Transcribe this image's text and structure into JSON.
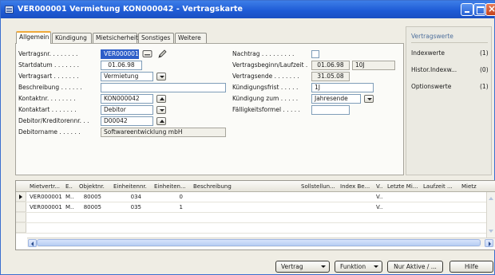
{
  "window": {
    "title": "VER000001 Vermietung KON000042 - Vertragskarte",
    "controls": {
      "minimize": "minimize-icon",
      "maximize": "maximize-icon",
      "close": "close-icon"
    }
  },
  "tabs": [
    {
      "label": "Allgemein",
      "active": true
    },
    {
      "label": "Kündigung"
    },
    {
      "label": "Mietsicherheit"
    },
    {
      "label": "Sonstiges"
    },
    {
      "label": "Weitere"
    }
  ],
  "form_left": [
    {
      "label": "Vertragsnr. . . . . . . .",
      "value": "VER000001"
    },
    {
      "label": "Startdatum . . . . . . .",
      "value": "01.06.98"
    },
    {
      "label": "Vertragsart . . . . . . .",
      "value": "Vermietung"
    },
    {
      "label": "Beschreibung . . . . . .",
      "value": ""
    },
    {
      "label": "Kontaktnr. . . . . . . .",
      "value": "KON000042"
    },
    {
      "label": "Kontaktart . . . . . . .",
      "value": "Debitor"
    },
    {
      "label": "Debitor/Kreditorennr. . .",
      "value": "D00042"
    },
    {
      "label": "Debitorname . . . . . .",
      "value": "Softwareentwicklung mbH"
    }
  ],
  "form_right": [
    {
      "label": "Nachtrag . . . . . . . . ."
    },
    {
      "label": "Vertragsbeginn/Laufzeit .",
      "value": "01.06.98",
      "value2": "10J"
    },
    {
      "label": "Vertragsende . . . . . . .",
      "value": "31.05.08"
    },
    {
      "label": "Kündigungsfrist . . . . .",
      "value": "1J"
    },
    {
      "label": "Kündigung zum . . . . .",
      "value": "Jahresende"
    },
    {
      "label": "Fälligkeitsformel . . . . .",
      "value": ""
    }
  ],
  "side_panel": {
    "header": "Vertragswerte",
    "items": [
      {
        "label": "Indexwerte",
        "count": "(1)"
      },
      {
        "label": "Histor.Indexw...",
        "count": "(0)"
      },
      {
        "label": "Optionswerte",
        "count": "(1)"
      }
    ]
  },
  "grid": {
    "columns": [
      "Mietvertr...",
      "E..",
      "Objektnr.",
      "Einheitennr.",
      "Einheiten...",
      "Beschreibung",
      "Sollstellun...",
      "Index Be...",
      "V..",
      "Letzte Mi...",
      "Laufzeit ...",
      "Mietz"
    ],
    "rows": [
      [
        "VER000001",
        "M..",
        "80005",
        "034",
        "0",
        "",
        "",
        "",
        "V..",
        "",
        "",
        ""
      ],
      [
        "VER000001",
        "M..",
        "80005",
        "035",
        "1",
        "",
        "",
        "",
        "V..",
        "",
        "",
        ""
      ]
    ]
  },
  "buttons": {
    "vertrag": "Vertrag",
    "funktion": "Funktion",
    "nur_aktive": "Nur Aktive / ...",
    "hilfe": "Hilfe"
  }
}
